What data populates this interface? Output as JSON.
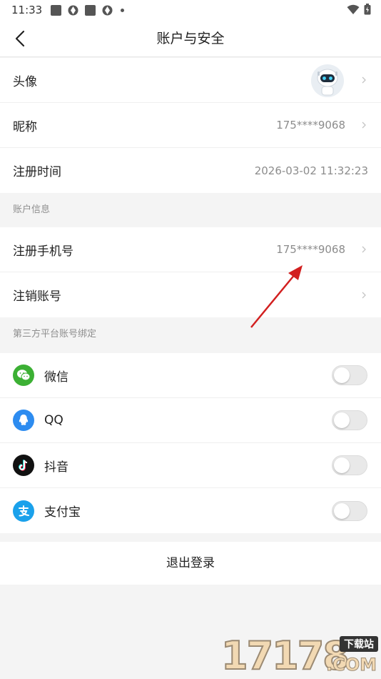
{
  "status_bar": {
    "time": "11:33"
  },
  "header": {
    "title": "账户与安全"
  },
  "profile": {
    "rows": [
      {
        "label": "头像"
      },
      {
        "label": "昵称",
        "value": "175****9068"
      },
      {
        "label": "注册时间",
        "value": "2026-03-02 11:32:23"
      }
    ]
  },
  "account_info": {
    "title": "账户信息",
    "rows": [
      {
        "label": "注册手机号",
        "value": "175****9068"
      },
      {
        "label": "注销账号"
      }
    ]
  },
  "third_party": {
    "title": "第三方平台账号绑定",
    "rows": [
      {
        "label": "微信",
        "icon": "wechat-icon",
        "color": "#3cb034",
        "bound": false
      },
      {
        "label": "QQ",
        "icon": "qq-icon",
        "color": "#2d8cf0",
        "bound": false
      },
      {
        "label": "抖音",
        "icon": "douyin-icon",
        "color": "#111111",
        "bound": false
      },
      {
        "label": "支付宝",
        "icon": "alipay-icon",
        "color": "#1aa1eb",
        "bound": false
      }
    ]
  },
  "logout": {
    "label": "退出登录"
  },
  "watermark": {
    "number": "17178",
    "tag": "下载站",
    "domain": ".COM"
  }
}
